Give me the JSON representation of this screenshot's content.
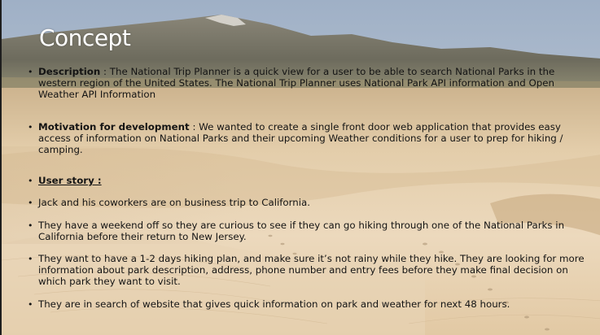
{
  "slide": {
    "title": "Concept",
    "bullet_glyph": "•",
    "items": [
      {
        "label": "Description",
        "text": " : The National Trip Planner is a quick view for a user to be able to search National Parks in the western region of the United States. The National Trip Planner uses National Park API information and Open Weather API Information"
      },
      {
        "label": "Motivation for development",
        "text": " : We wanted to create a single front door web application that provides easy access of information on National Parks and their upcoming Weather conditions for a user to prep for hiking / camping."
      },
      {
        "label": "User story :",
        "text": ""
      },
      {
        "label": "",
        "text": "Jack and his coworkers are on business trip to California."
      },
      {
        "label": "",
        "text": "They have a weekend off so they are curious to see if they can go hiking through one of the National Parks in California before their return to New Jersey."
      },
      {
        "label": "",
        "text": "They want to have a 1-2 days hiking plan, and make sure it’s not rainy while they hike. They are looking for more information about park description, address, phone number and entry fees before they make final decision on which park they want to visit."
      },
      {
        "label": "",
        "text": "They are in search of website that gives quick information on park and weather for next 48 hours."
      }
    ]
  },
  "colors": {
    "sky_top": "#a9b6c8",
    "mountain": "#6f6a5e",
    "sand_light": "#ecd8bb",
    "sand_mid": "#dcc29e",
    "text": "#141414",
    "title": "#ffffff"
  }
}
